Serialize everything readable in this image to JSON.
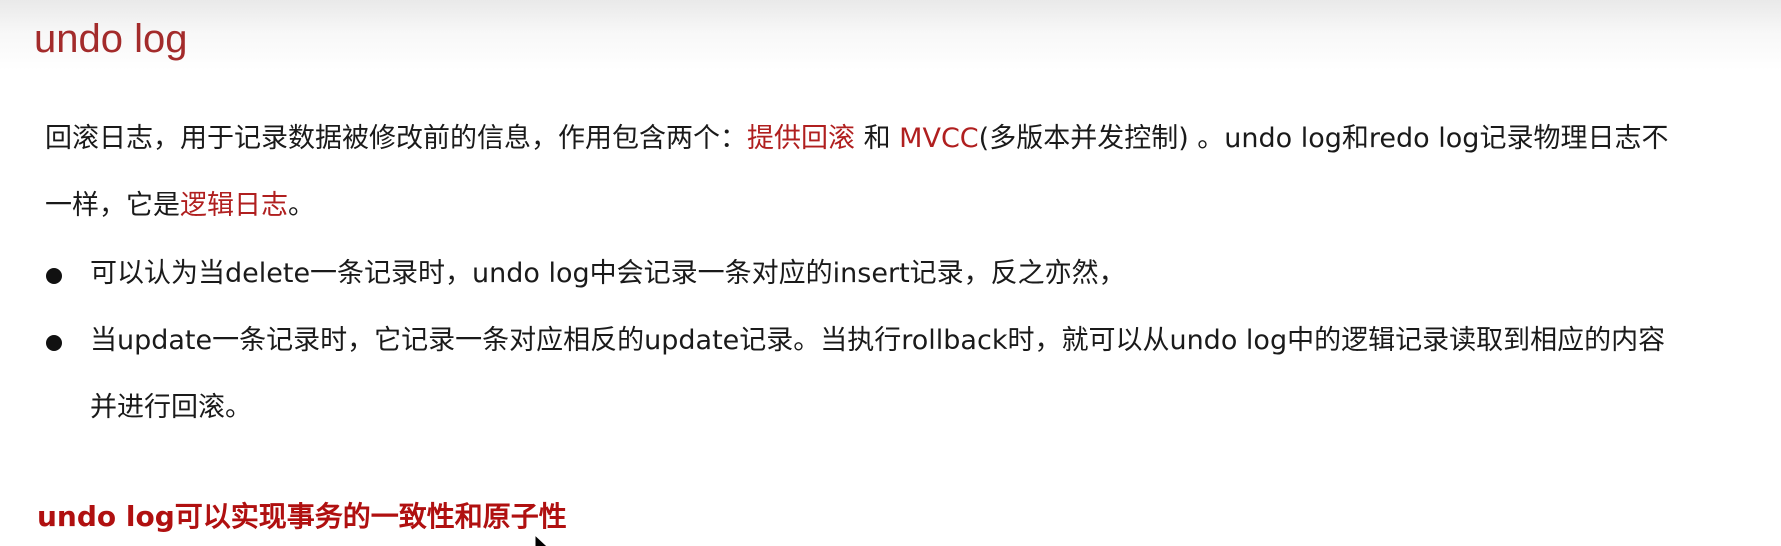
{
  "title": "undo log",
  "intro": {
    "text1": "回滚日志，用于记录数据被修改前的信息，作用包含两个：",
    "highlight1": "提供回滚",
    "text2": " 和 ",
    "highlight2": "MVCC",
    "text3": "(多版本并发控制) 。undo log和redo log记录物理日志不",
    "text4": "一样，它是",
    "highlight3": "逻辑日志",
    "text5": "。"
  },
  "bullets": [
    {
      "line1": "可以认为当delete一条记录时，undo log中会记录一条对应的insert记录，反之亦然，"
    },
    {
      "line1": "当update一条记录时，它记录一条对应相反的update记录。当执行rollback时，就可以从undo log中的逻辑记录读取到相应的内容",
      "line2": "并进行回滚。"
    }
  ],
  "conclusion": "undo log可以实现事务的一致性和原子性",
  "colors": {
    "title": "#a32b2b",
    "highlight": "#b01f1f",
    "conclusion": "#b01010"
  },
  "icons": {
    "bullet": "filled-circle",
    "cursor": "mouse-pointer-icon"
  }
}
